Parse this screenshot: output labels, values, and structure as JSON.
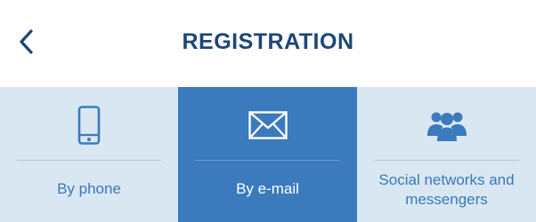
{
  "header": {
    "title": "REGISTRATION",
    "back_icon": "chevron-left-icon"
  },
  "tabs": [
    {
      "label": "By phone",
      "icon": "smartphone-icon",
      "selected": false
    },
    {
      "label": "By e-mail",
      "icon": "envelope-icon",
      "selected": true
    },
    {
      "label": "Social networks and messengers",
      "icon": "users-icon",
      "selected": false
    }
  ],
  "colors": {
    "title": "#1d4677",
    "tab_background": "#d9e7f3",
    "tab_selected_background": "#3a7abd",
    "tab_label": "#3a78b8",
    "tab_selected_label": "#ffffff",
    "divider": "#b3c7da"
  }
}
